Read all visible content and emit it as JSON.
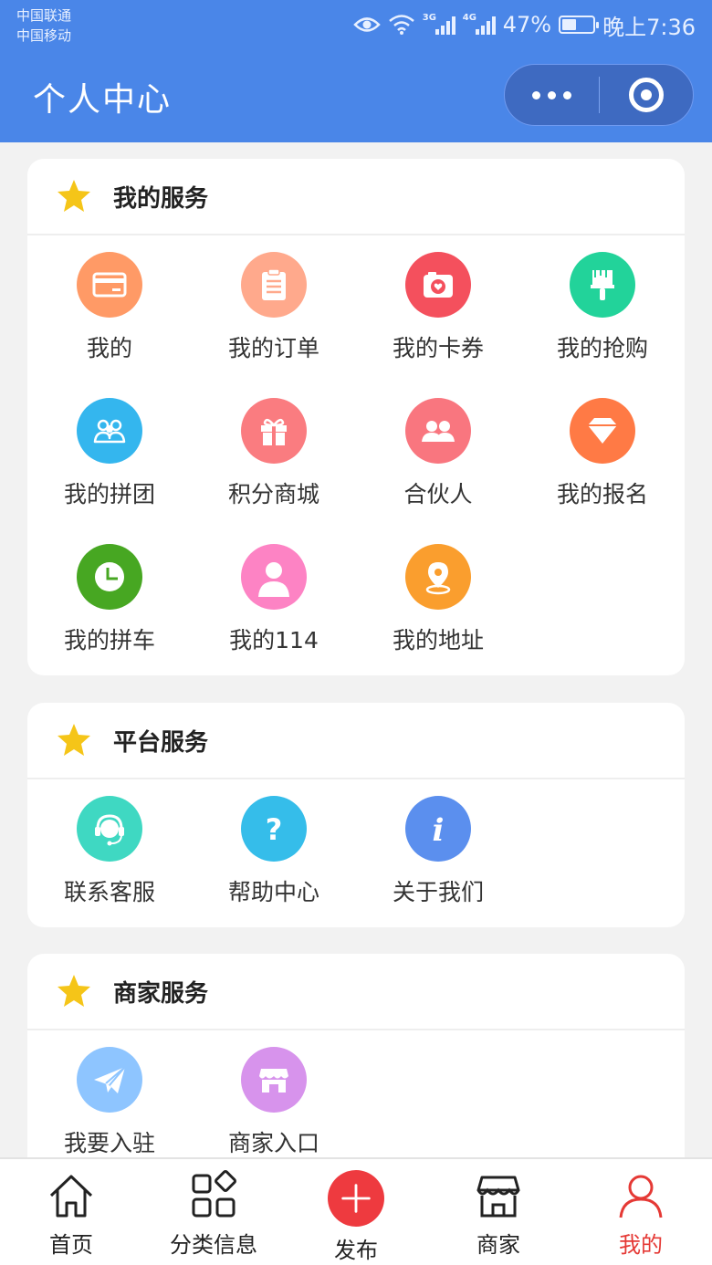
{
  "status_bar": {
    "carrier_1": "中国联通",
    "carrier_2": "中国移动",
    "signal_1_tag": "3G",
    "signal_2_tag": "4G",
    "battery_percent": "47%",
    "battery_level": 0.47,
    "time": "晚上7:36"
  },
  "header": {
    "title": "个人中心",
    "menu_icon": "more-dots-icon",
    "close_icon": "target-circle-icon",
    "color": "#4a86e8"
  },
  "sections": [
    {
      "title": "我的服务",
      "items": [
        {
          "label": "我的",
          "icon": "card-icon",
          "color": "#ff9a66"
        },
        {
          "label": "我的订单",
          "icon": "clipboard-icon",
          "color": "#ffa98c"
        },
        {
          "label": "我的卡券",
          "icon": "photo-heart-icon",
          "color": "#f4505d"
        },
        {
          "label": "我的抢购",
          "icon": "brush-icon",
          "color": "#22d39a"
        },
        {
          "label": "我的拼团",
          "icon": "group-icon",
          "color": "#34b6ee"
        },
        {
          "label": "积分商城",
          "icon": "gift-icon",
          "color": "#fa7c80"
        },
        {
          "label": "合伙人",
          "icon": "partners-icon",
          "color": "#f9767f"
        },
        {
          "label": "我的报名",
          "icon": "diamond-icon",
          "color": "#ff7a45"
        },
        {
          "label": "我的拼车",
          "icon": "clock-icon",
          "color": "#47a722"
        },
        {
          "label": "我的114",
          "icon": "person-icon",
          "color": "#fd83c4"
        },
        {
          "label": "我的地址",
          "icon": "location-pin-icon",
          "color": "#fa9e2e"
        }
      ]
    },
    {
      "title": "平台服务",
      "items": [
        {
          "label": "联系客服",
          "icon": "headset-icon",
          "color": "#3fd8c2"
        },
        {
          "label": "帮助中心",
          "icon": "question-icon",
          "color": "#35bdea"
        },
        {
          "label": "关于我们",
          "icon": "info-icon",
          "color": "#5b8fee"
        }
      ]
    },
    {
      "title": "商家服务",
      "items": [
        {
          "label": "我要入驻",
          "icon": "paper-plane-icon",
          "color": "#8ec5ff"
        },
        {
          "label": "商家入口",
          "icon": "store-icon",
          "color": "#d793ec"
        }
      ]
    }
  ],
  "tabbar": {
    "active_color": "#e53935",
    "tabs": [
      {
        "label": "首页",
        "icon": "home-icon"
      },
      {
        "label": "分类信息",
        "icon": "category-icon"
      },
      {
        "label": "发布",
        "icon": "plus-icon"
      },
      {
        "label": "商家",
        "icon": "shop-icon"
      },
      {
        "label": "我的",
        "icon": "user-icon"
      }
    ]
  }
}
